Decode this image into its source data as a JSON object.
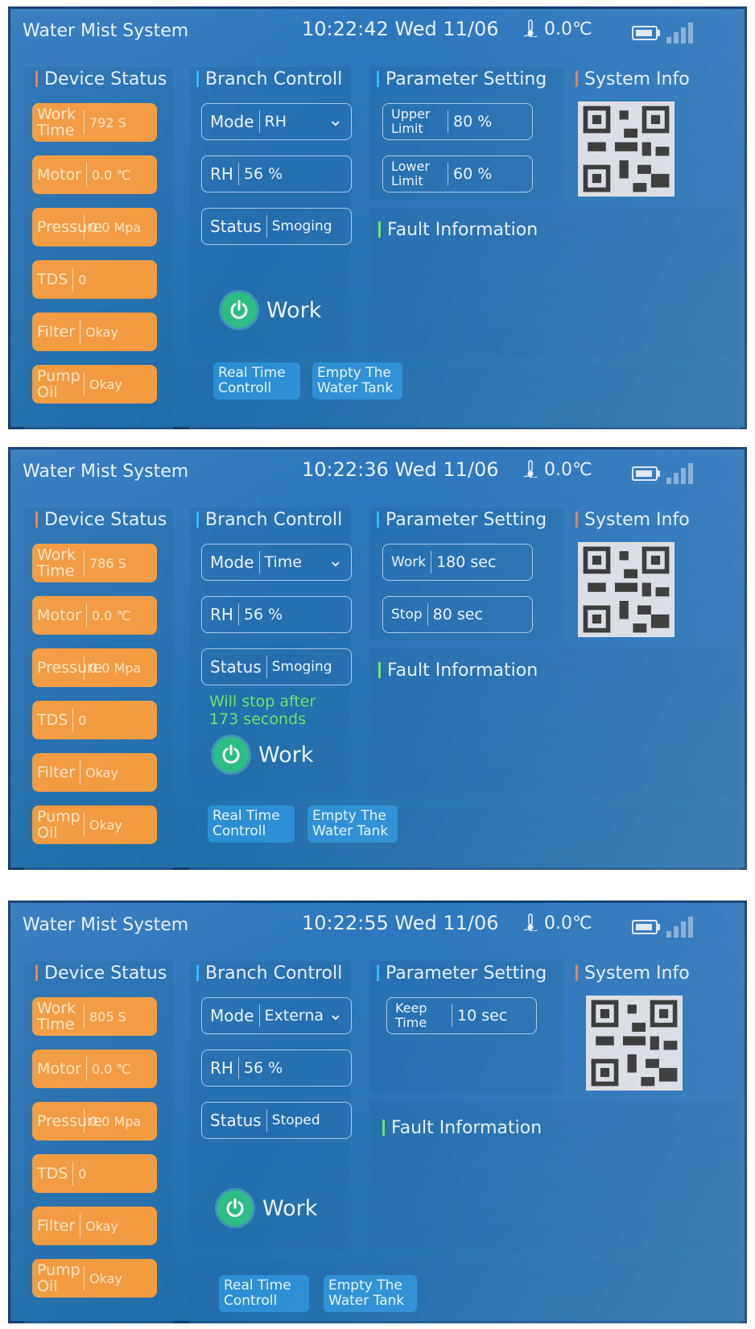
{
  "screens": [
    {
      "title": "Water Mist System",
      "clock": "10:22:42 Wed 11/06",
      "temperature": "0.0℃",
      "sections": {
        "device_status": "Device Status",
        "branch_control": "Branch Controll",
        "parameter_setting": "Parameter Setting",
        "system_info": "System Info",
        "fault_information": "Fault Information"
      },
      "device_status": [
        {
          "label": "Work Time",
          "value": "792 S"
        },
        {
          "label": "Motor",
          "value": "0.0 ℃"
        },
        {
          "label": "Pressure",
          "value": "0.0  Mpa"
        },
        {
          "label": "TDS",
          "value": "0"
        },
        {
          "label": "Filter",
          "value": "Okay"
        },
        {
          "label": "Pump Oil",
          "value": "Okay"
        }
      ],
      "branch": {
        "mode_label": "Mode",
        "mode_value": "RH",
        "rh_label": "RH",
        "rh_value": "56 %",
        "status_label": "Status",
        "status_value": "Smoging"
      },
      "params": [
        {
          "label": "Upper Limit",
          "value": "80 %"
        },
        {
          "label": "Lower Limit",
          "value": "60 %"
        }
      ],
      "message": "",
      "work_label": "Work",
      "actions": [
        "Real Time Controll",
        "Empty The Water Tank"
      ]
    },
    {
      "title": "Water Mist System",
      "clock": "10:22:36 Wed 11/06",
      "temperature": "0.0℃",
      "sections": {
        "device_status": "Device Status",
        "branch_control": "Branch Controll",
        "parameter_setting": "Parameter Setting",
        "system_info": "System Info",
        "fault_information": "Fault Information"
      },
      "device_status": [
        {
          "label": "Work Time",
          "value": "786 S"
        },
        {
          "label": "Motor",
          "value": "0.0 ℃"
        },
        {
          "label": "Pressure",
          "value": "0.0  Mpa"
        },
        {
          "label": "TDS",
          "value": "0"
        },
        {
          "label": "Filter",
          "value": "Okay"
        },
        {
          "label": "Pump Oil",
          "value": "Okay"
        }
      ],
      "branch": {
        "mode_label": "Mode",
        "mode_value": "Time",
        "rh_label": "RH",
        "rh_value": "56 %",
        "status_label": "Status",
        "status_value": "Smoging"
      },
      "params": [
        {
          "label": "Work",
          "value": "180 sec"
        },
        {
          "label": "Stop",
          "value": "80 sec"
        }
      ],
      "message": "Will stop after 173 seconds",
      "work_label": "Work",
      "actions": [
        "Real Time Controll",
        "Empty The Water Tank"
      ]
    },
    {
      "title": "Water Mist System",
      "clock": "10:22:55 Wed 11/06",
      "temperature": "0.0℃",
      "sections": {
        "device_status": "Device Status",
        "branch_control": "Branch Controll",
        "parameter_setting": "Parameter Setting",
        "system_info": "System Info",
        "fault_information": "Fault Information"
      },
      "device_status": [
        {
          "label": "Work Time",
          "value": "805 S"
        },
        {
          "label": "Motor",
          "value": "0.0 ℃"
        },
        {
          "label": "Pressure",
          "value": "0.0  Mpa"
        },
        {
          "label": "TDS",
          "value": "0"
        },
        {
          "label": "Filter",
          "value": "Okay"
        },
        {
          "label": "Pump Oil",
          "value": "Okay"
        }
      ],
      "branch": {
        "mode_label": "Mode",
        "mode_value": "Externa",
        "rh_label": "RH",
        "rh_value": "56 %",
        "status_label": "Status",
        "status_value": "Stoped"
      },
      "params": [
        {
          "label": "Keep Time",
          "value": "10 sec"
        }
      ],
      "message": "",
      "work_label": "Work",
      "actions": [
        "Real Time Controll",
        "Empty The Water Tank"
      ]
    }
  ],
  "colors": {
    "status_orange": "#f29a3e",
    "power_green": "#2cbd86",
    "message_green": "#6fe26a",
    "action_blue": "#2a8ed3"
  },
  "icons": [
    "thermometer-icon",
    "battery-icon",
    "signal-icon",
    "chevron-down-icon",
    "power-icon",
    "qr-code"
  ]
}
